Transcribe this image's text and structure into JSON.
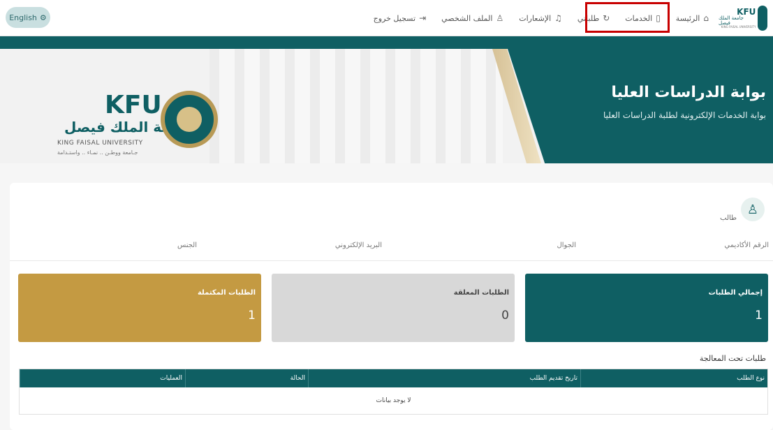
{
  "header": {
    "lang_button": "English",
    "nav": {
      "home": "الرئيسة",
      "services": "الخدمات",
      "my_requests": "طلباتي",
      "notifications": "الإشعارات",
      "profile": "الملف الشخصي",
      "logout": "تسجيل خروج"
    },
    "logo": {
      "kfu": "KFU",
      "arabic": "جامعة الملك فيصل",
      "english": "KING FAISAL UNIVERSITY"
    }
  },
  "banner": {
    "title": "بوابة الدراسات العليا",
    "subtitle": "بوابة الخدمات الإلكترونية لطلبة الدراسات العليا",
    "logo_kfu": "KFU",
    "logo_arabic": "جامعة الملك فيصل",
    "logo_english": "KING FAISAL UNIVERSITY",
    "logo_tagline": "جـامعة ووطـن .. نمـاء .. واستـدامة"
  },
  "profile": {
    "role": "طالب",
    "fields": {
      "academic_id": "الرقم الأكاديمي",
      "mobile": "الجوال",
      "email": "البريد الإلكتروني",
      "gender": "الجنس"
    }
  },
  "stats": {
    "total": {
      "label": "إجمالي الطلبات",
      "value": "1"
    },
    "pending": {
      "label": "الطلبات المعلقة",
      "value": "0"
    },
    "completed": {
      "label": "الطلبات المكتملة",
      "value": "1"
    }
  },
  "requests": {
    "title": "طلبات تحت المعالجة",
    "columns": [
      "نوع الطلب",
      "تاريخ تقديم الطلب",
      "الحالة",
      "العمليات"
    ],
    "empty": "لا يوجد بيانات"
  },
  "colors": {
    "primary": "#0f5f63",
    "gold": "#c49a42",
    "pending": "#d8d8d8",
    "highlight": "#c80000"
  }
}
